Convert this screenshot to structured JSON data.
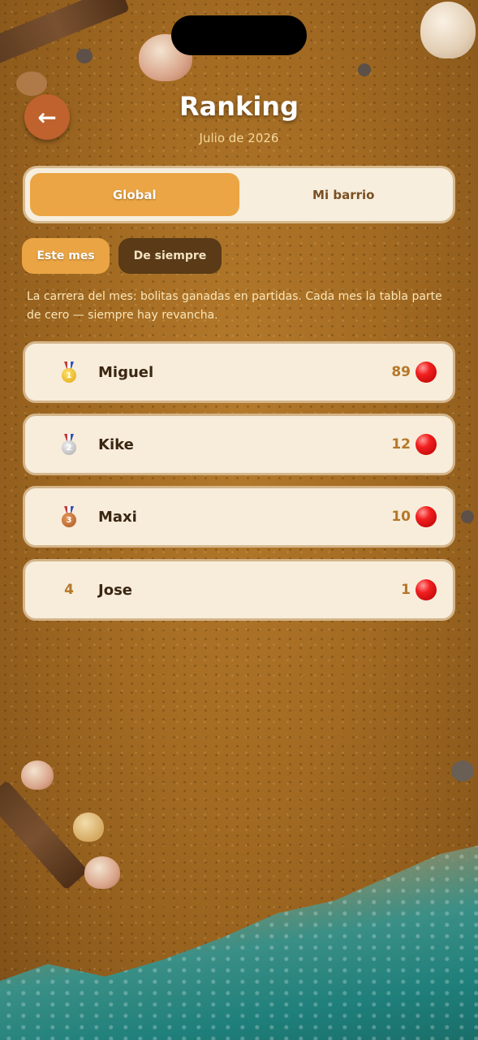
{
  "header": {
    "title": "Ranking",
    "subtitle": "Julio de 2026"
  },
  "tabs": [
    {
      "label": "Global",
      "active": true
    },
    {
      "label": "Mi barrio",
      "active": false
    }
  ],
  "filters": [
    {
      "label": "Este mes",
      "active": true
    },
    {
      "label": "De siempre",
      "active": false
    }
  ],
  "description": "La carrera del mes: bolitas ganadas en partidas. Cada mes la tabla parte de cero — siempre hay revancha.",
  "ranking": [
    {
      "rank": "1",
      "medal": "gold-medal-icon",
      "name": "Miguel",
      "score": "89"
    },
    {
      "rank": "2",
      "medal": "silver-medal-icon",
      "name": "Kike",
      "score": "12"
    },
    {
      "rank": "3",
      "medal": "bronze-medal-icon",
      "name": "Maxi",
      "score": "10"
    },
    {
      "rank": "4",
      "medal": null,
      "name": "Jose",
      "score": "1"
    }
  ],
  "icons": {
    "back": "arrow-left-icon",
    "score": "red-marble-icon"
  },
  "colors": {
    "accent": "#eba544",
    "back_button": "#c0622d",
    "card_bg": "#f7edda",
    "score_text": "#b5772a",
    "marble": "#f21f1f"
  }
}
